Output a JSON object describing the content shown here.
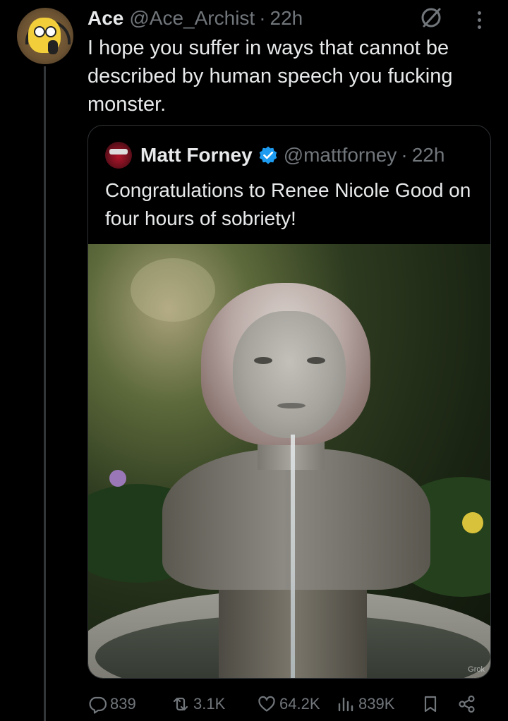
{
  "post": {
    "display_name": "Ace",
    "handle": "@Ace_Archist",
    "dot": "·",
    "time": "22h",
    "text": "I hope you suffer in ways that cannot be described by human speech you fucking monster."
  },
  "quote": {
    "display_name": "Matt Forney",
    "handle": "@mattforney",
    "dot": "·",
    "time": "22h",
    "text": "Congratulations to Renee Nicole Good on four hours of sobriety!",
    "image_watermark": "Grok"
  },
  "actions": {
    "replies": "839",
    "reposts": "3.1K",
    "likes": "64.2K",
    "views": "839K"
  },
  "colors": {
    "background": "#000000",
    "text": "#e7e9ea",
    "muted": "#71767b",
    "verified": "#1d9bf0",
    "border": "#2f3336"
  },
  "icons": [
    "grok-icon",
    "more-icon",
    "verified-icon",
    "reply-icon",
    "repost-icon",
    "like-icon",
    "views-icon",
    "bookmark-icon",
    "share-icon"
  ]
}
